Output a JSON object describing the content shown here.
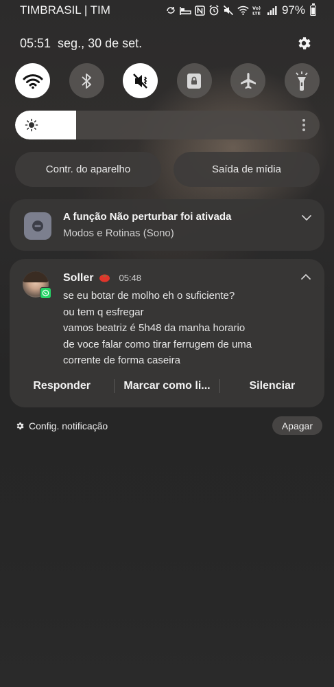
{
  "status_bar": {
    "carrier": "TIMBRASIL | TIM",
    "icons": [
      "sync-icon",
      "sleep-icon",
      "nfc-icon",
      "alarm-icon",
      "mute-icon",
      "wifi-icon",
      "volte-icon",
      "signal-icon"
    ],
    "battery_percent": "97%"
  },
  "header": {
    "time": "05:51",
    "date": "seg., 30 de set."
  },
  "quick_tiles": [
    {
      "name": "wifi",
      "state": "on"
    },
    {
      "name": "bluetooth",
      "state": "off"
    },
    {
      "name": "mute",
      "state": "on"
    },
    {
      "name": "rotation-lock",
      "state": "off"
    },
    {
      "name": "airplane-mode",
      "state": "off"
    },
    {
      "name": "flashlight",
      "state": "off"
    }
  ],
  "brightness": {
    "level": 0.2
  },
  "pills": {
    "device_control": "Contr. do aparelho",
    "media_output": "Saída de mídia"
  },
  "dnd_notification": {
    "title": "A função Não perturbar foi ativada",
    "subtitle": "Modos e Rotinas (Sono)"
  },
  "message_notification": {
    "sender": "Soller",
    "time": "05:48",
    "lines": [
      "se eu botar de molho eh o suficiente?",
      "ou tem q esfregar",
      "vamos beatriz é 5h48 da manha horario",
      "de voce falar como tirar ferrugem de uma",
      "corrente de forma caseira"
    ],
    "actions": {
      "reply": "Responder",
      "mark_read": "Marcar como li...",
      "mute": "Silenciar"
    }
  },
  "footer": {
    "notification_settings": "Config. notificação",
    "clear": "Apagar"
  },
  "colors": {
    "tile_on": "#ffffff",
    "tile_off": "#5a5856",
    "card_bg": "#383736",
    "whatsapp": "#25d366"
  }
}
